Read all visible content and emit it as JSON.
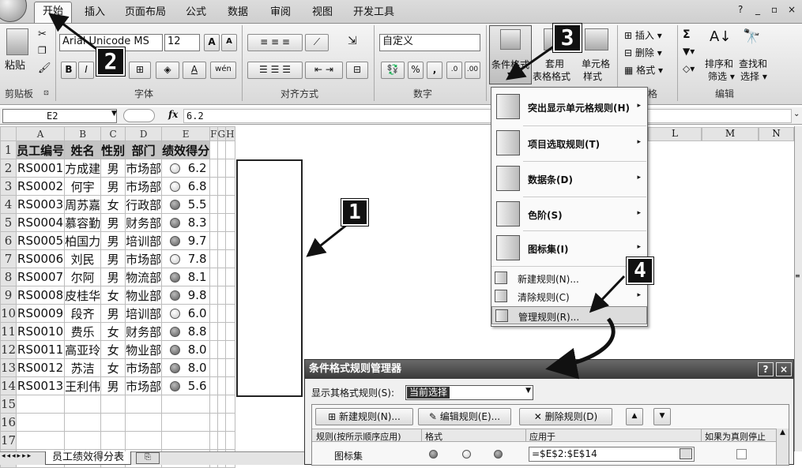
{
  "ribbon_tabs": [
    "开始",
    "插入",
    "页面布局",
    "公式",
    "数据",
    "审阅",
    "视图",
    "开发工具"
  ],
  "window_controls": {
    "help": "❷",
    "minimize": "_",
    "restore": "▫",
    "close": "×"
  },
  "clipboard": {
    "paste": "粘贴",
    "label": "剪贴板"
  },
  "font": {
    "name": "Arial Unicode MS",
    "size": "12",
    "label": "字体",
    "grow": "A",
    "shrink": "A",
    "bold": "B",
    "italic": "I",
    "phonetic": "wén"
  },
  "alignment": {
    "label": "对齐方式"
  },
  "number": {
    "format": "自定义",
    "label": "数字",
    "percent": "%",
    "comma": ","
  },
  "styles": {
    "cond_format": "条件格式",
    "table_format_1": "套用",
    "table_format_2": "表格格式",
    "cell_style_1": "单元格",
    "cell_style_2": "样式",
    "label_tail": "格"
  },
  "cells": {
    "insert": "插入",
    "delete": "删除",
    "format": "格式"
  },
  "editing": {
    "sigma": "Σ",
    "sort_1": "排序和",
    "sort_2": "筛选",
    "find_1": "查找和",
    "find_2": "选择",
    "label": "编辑"
  },
  "formula_bar": {
    "name_box": "E2",
    "fx": "fx",
    "value": "6.2"
  },
  "columns": [
    "A",
    "B",
    "C",
    "D",
    "E",
    "F",
    "G",
    "H",
    "L",
    "M",
    "N"
  ],
  "headers": [
    "员工编号",
    "姓名",
    "性别",
    "部门",
    "绩效得分"
  ],
  "rows": [
    {
      "n": "2",
      "id": "RS0001",
      "name": "方成建",
      "sex": "男",
      "dept": "市场部",
      "score": "6.2",
      "level": "light"
    },
    {
      "n": "3",
      "id": "RS0002",
      "name": "何宇",
      "sex": "男",
      "dept": "市场部",
      "score": "6.8",
      "level": "light"
    },
    {
      "n": "4",
      "id": "RS0003",
      "name": "周苏嘉",
      "sex": "女",
      "dept": "行政部",
      "score": "5.5",
      "level": "dark"
    },
    {
      "n": "5",
      "id": "RS0004",
      "name": "慕容勤",
      "sex": "男",
      "dept": "财务部",
      "score": "8.3",
      "level": "dark"
    },
    {
      "n": "6",
      "id": "RS0005",
      "name": "柏国力",
      "sex": "男",
      "dept": "培训部",
      "score": "9.7",
      "level": "dark"
    },
    {
      "n": "7",
      "id": "RS0006",
      "name": "刘民",
      "sex": "男",
      "dept": "市场部",
      "score": "7.8",
      "level": "light"
    },
    {
      "n": "8",
      "id": "RS0007",
      "name": "尔阿",
      "sex": "男",
      "dept": "物流部",
      "score": "8.1",
      "level": "dark"
    },
    {
      "n": "9",
      "id": "RS0008",
      "name": "皮桂华",
      "sex": "女",
      "dept": "物业部",
      "score": "9.8",
      "level": "dark"
    },
    {
      "n": "10",
      "id": "RS0009",
      "name": "段齐",
      "sex": "男",
      "dept": "培训部",
      "score": "6.0",
      "level": "light"
    },
    {
      "n": "11",
      "id": "RS0010",
      "name": "费乐",
      "sex": "女",
      "dept": "财务部",
      "score": "8.8",
      "level": "dark"
    },
    {
      "n": "12",
      "id": "RS0011",
      "name": "高亚玲",
      "sex": "女",
      "dept": "物业部",
      "score": "8.0",
      "level": "dark"
    },
    {
      "n": "13",
      "id": "RS0012",
      "name": "苏洁",
      "sex": "女",
      "dept": "市场部",
      "score": "8.0",
      "level": "dark"
    },
    {
      "n": "14",
      "id": "RS0013",
      "name": "王利伟",
      "sex": "男",
      "dept": "市场部",
      "score": "5.6",
      "level": "dark"
    }
  ],
  "empty_rows": [
    "15",
    "16",
    "17",
    "18"
  ],
  "sheet_tab": "员工绩效得分表",
  "menu": {
    "items": [
      "突出显示单元格规则(H)",
      "项目选取规则(T)",
      "数据条(D)",
      "色阶(S)",
      "图标集(I)"
    ],
    "commands": [
      "新建规则(N)...",
      "清除规则(C)",
      "管理规则(R)..."
    ]
  },
  "dialog": {
    "title": "条件格式规则管理器",
    "show_label": "显示其格式规则(S):",
    "show_value": "当前选择",
    "new_rule": "新建规则(N)...",
    "edit_rule": "编辑规则(E)...",
    "delete_rule": "删除规则(D)",
    "col_rule": "规则(按所示顺序应用)",
    "col_format": "格式",
    "col_applies": "应用于",
    "col_stop": "如果为真则停止",
    "rule_name": "图标集",
    "rule_range": "=$E$2:$E$14",
    "help": "?",
    "close": "×"
  },
  "callouts": [
    "1",
    "2",
    "3",
    "4"
  ]
}
